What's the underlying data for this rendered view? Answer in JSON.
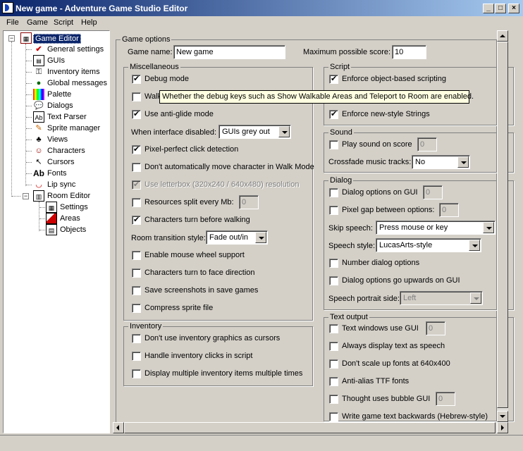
{
  "window": {
    "title": "New game - Adventure Game Studio Editor",
    "min": "_",
    "max": "□",
    "close": "×"
  },
  "menu": [
    "File",
    "Game",
    "Script",
    "Help"
  ],
  "tree": {
    "root": "Game Editor",
    "items": [
      "General settings",
      "GUIs",
      "Inventory items",
      "Global messages",
      "Palette",
      "Dialogs",
      "Text Parser",
      "Sprite manager",
      "Views",
      "Characters",
      "Cursors",
      "Fonts",
      "Lip sync"
    ],
    "room": "Room Editor",
    "room_items": [
      "Settings",
      "Areas",
      "Objects"
    ]
  },
  "game_options": {
    "title": "Game options",
    "name_label": "Game name:",
    "name_value": "New game",
    "score_label": "Maximum possible score:",
    "score_value": "10"
  },
  "misc": {
    "title": "Miscellaneous",
    "debug_mode": "Debug mode",
    "walk_partial": "Walk",
    "anti_glide": "Use anti-glide mode",
    "interface_disabled_label": "When interface disabled:",
    "interface_disabled_value": "GUIs grey out",
    "pixel_perfect": "Pixel-perfect click detection",
    "dont_auto_move": "Don't automatically move character in Walk Mode",
    "letterbox": "Use letterbox (320x240 / 640x480) resolution",
    "resources_split": "Resources split every Mb:",
    "resources_split_value": "0",
    "chars_turn_walking": "Characters turn before walking",
    "room_transition_label": "Room transition style:",
    "room_transition_value": "Fade out/in",
    "mouse_wheel": "Enable mouse wheel support",
    "chars_turn_face": "Characters turn to face direction",
    "save_screenshots": "Save screenshots in save games",
    "compress_sprite": "Compress sprite file"
  },
  "inventory": {
    "title": "Inventory",
    "dont_use_cursors": "Don't use inventory graphics as cursors",
    "handle_clicks": "Handle inventory clicks in script",
    "display_multiple": "Display multiple inventory items multiple times"
  },
  "script": {
    "title": "Script",
    "enforce_object": "Enforce object-based scripting",
    "enforce_strings": "Enforce new-style Strings"
  },
  "sound": {
    "title": "Sound",
    "play_on_score": "Play sound on score",
    "play_on_score_value": "0",
    "crossfade_label": "Crossfade music tracks:",
    "crossfade_value": "No"
  },
  "dialog": {
    "title": "Dialog",
    "options_on_gui": "Dialog options on GUI",
    "options_on_gui_value": "0",
    "pixel_gap": "Pixel gap between options:",
    "pixel_gap_value": "0",
    "skip_speech_label": "Skip speech:",
    "skip_speech_value": "Press mouse or key",
    "speech_style_label": "Speech style:",
    "speech_style_value": "LucasArts-style",
    "number_options": "Number dialog options",
    "options_upwards": "Dialog options go upwards on GUI",
    "portrait_side_label": "Speech portrait side:",
    "portrait_side_value": "Left"
  },
  "text_output": {
    "title": "Text output",
    "text_windows_gui": "Text windows use GUI",
    "text_windows_gui_value": "0",
    "always_speech": "Always display text as speech",
    "dont_scale_fonts": "Don't scale up fonts at 640x400",
    "anti_alias": "Anti-alias TTF fonts",
    "thought_bubble": "Thought uses bubble GUI",
    "thought_bubble_value": "0",
    "backwards": "Write game text backwards (Hebrew-style)"
  },
  "tooltip": "Whether the debug keys such as Show Walkable Areas and Teleport to Room are enabled."
}
